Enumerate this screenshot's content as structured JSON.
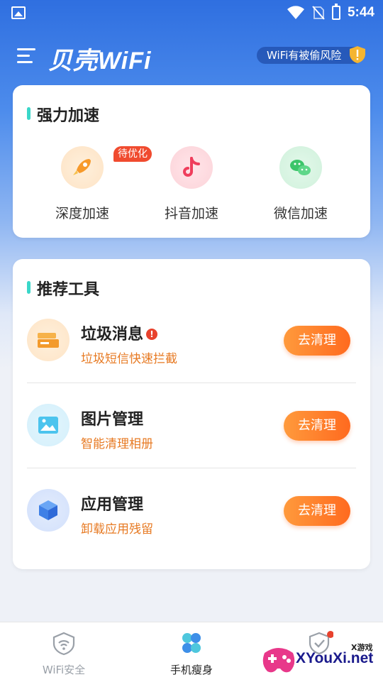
{
  "status_bar": {
    "time": "5:44"
  },
  "header": {
    "logo": "贝壳WiFi",
    "risk_pill": "WiFi有被偷风险"
  },
  "boost_card": {
    "title": "强力加速",
    "items": [
      {
        "label": "深度加速",
        "badge": "待优化",
        "icon": "rocket-icon"
      },
      {
        "label": "抖音加速",
        "icon": "tiktok-icon"
      },
      {
        "label": "微信加速",
        "icon": "wechat-icon"
      }
    ]
  },
  "tools_card": {
    "title": "推荐工具",
    "items": [
      {
        "name": "垃圾消息",
        "desc": "垃圾短信快速拦截",
        "button": "去清理",
        "icon": "trash-message-icon",
        "alert": "!"
      },
      {
        "name": "图片管理",
        "desc": "智能清理相册",
        "button": "去清理",
        "icon": "image-icon"
      },
      {
        "name": "应用管理",
        "desc": "卸载应用残留",
        "button": "去清理",
        "icon": "app-cube-icon"
      }
    ]
  },
  "bottom_nav": {
    "items": [
      {
        "label": "WiFi安全",
        "icon": "wifi-icon",
        "active": false
      },
      {
        "label": "手机瘦身",
        "icon": "clover-icon",
        "active": true
      },
      {
        "label": "",
        "icon": "shield-check-icon",
        "active": false
      }
    ]
  },
  "watermark": {
    "text": "XYouXi.net",
    "small": "X游戏"
  },
  "colors": {
    "accent_orange": "#ff7a2a",
    "primary_blue": "#2f6fe0",
    "teal": "#3ad7c9"
  }
}
